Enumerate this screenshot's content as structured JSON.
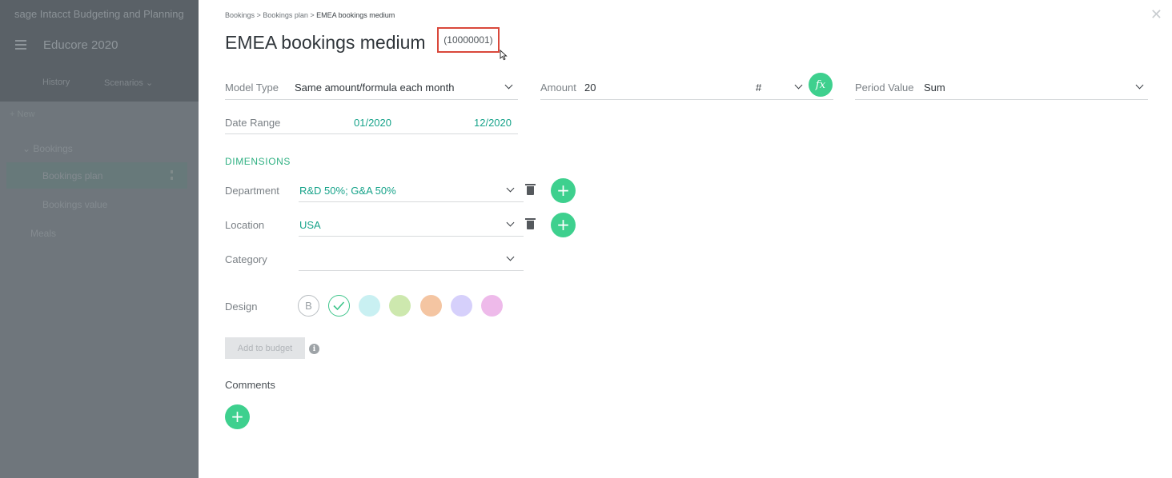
{
  "app": {
    "brand": "sage Intacct Budgeting and Planning",
    "title": "Educore 2020",
    "menu": {
      "history": "History",
      "scenarios": "Scenarios"
    },
    "new_label": "New",
    "tree": [
      {
        "label": "Bookings"
      },
      {
        "label": "Bookings plan"
      },
      {
        "label": "Bookings value"
      },
      {
        "label": "Meals"
      }
    ]
  },
  "breadcrumb": {
    "items": [
      "Bookings",
      "Bookings plan",
      "EMEA bookings medium"
    ],
    "separator": ">"
  },
  "header": {
    "title": "EMEA bookings medium",
    "id": "(10000001)"
  },
  "model": {
    "model_type_label": "Model Type",
    "model_type_value": "Same amount/formula each month",
    "amount_label": "Amount",
    "amount_value": "20",
    "unit_value": "#",
    "fx_label": "fx",
    "period_value_label": "Period Value",
    "period_value_value": "Sum",
    "date_range_label": "Date Range",
    "date_from": "01/2020",
    "date_to": "12/2020"
  },
  "dimensions": {
    "heading": "DIMENSIONS",
    "rows": [
      {
        "label": "Department",
        "value": "R&D 50%; G&A 50%"
      },
      {
        "label": "Location",
        "value": "USA"
      },
      {
        "label": "Category",
        "value": ""
      }
    ]
  },
  "design": {
    "label": "Design",
    "b_label": "B",
    "colors": [
      "#c9f0f2",
      "#cde8ae",
      "#f4c5a2",
      "#d6d0fb",
      "#eebaea"
    ]
  },
  "actions": {
    "add_to_budget": "Add to budget",
    "info": "i"
  },
  "comments": {
    "label": "Comments",
    "add": "+"
  },
  "icons": {
    "plus": "+",
    "close": "✕"
  }
}
